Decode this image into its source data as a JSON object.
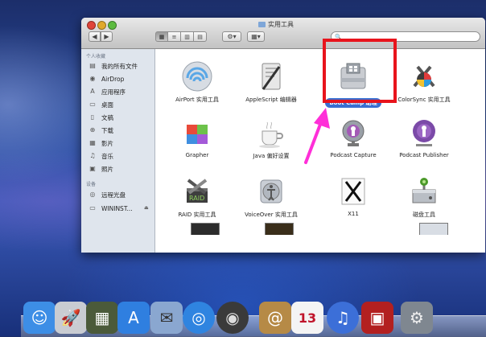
{
  "window": {
    "title": "实用工具",
    "search_placeholder": ""
  },
  "toolbar": {
    "back_label": "◀",
    "forward_label": "▶",
    "view_icon_label": "▦",
    "view_list_label": "≡",
    "view_column_label": "▥",
    "view_coverflow_label": "▤",
    "action_label": "⚙▾",
    "arrange_label": "▦▾",
    "search_glyph": "🔍"
  },
  "sidebar": {
    "favorites_header": "个人收藏",
    "favorites": [
      {
        "label": "我的所有文件",
        "icon": "all-files-icon",
        "glyph": "▤"
      },
      {
        "label": "AirDrop",
        "icon": "airdrop-icon",
        "glyph": "◉"
      },
      {
        "label": "应用程序",
        "icon": "applications-icon",
        "glyph": "A"
      },
      {
        "label": "桌面",
        "icon": "desktop-icon",
        "glyph": "▭"
      },
      {
        "label": "文稿",
        "icon": "documents-icon",
        "glyph": "▯"
      },
      {
        "label": "下载",
        "icon": "downloads-icon",
        "glyph": "⊕"
      },
      {
        "label": "影片",
        "icon": "movies-icon",
        "glyph": "▦"
      },
      {
        "label": "音乐",
        "icon": "music-icon",
        "glyph": "♫"
      },
      {
        "label": "照片",
        "icon": "photos-icon",
        "glyph": "▣"
      }
    ],
    "devices_header": "设备",
    "devices": [
      {
        "label": "远程光盘",
        "icon": "remote-disc-icon",
        "glyph": "◎"
      },
      {
        "label": "WININST...",
        "icon": "drive-icon",
        "glyph": "▭",
        "eject": "⏏"
      }
    ]
  },
  "apps": [
    {
      "label": "AirPort 实用工具",
      "icon": "airport-utility-icon"
    },
    {
      "label": "AppleScript 编辑器",
      "icon": "applescript-editor-icon"
    },
    {
      "label": "Boot Camp 助理",
      "icon": "boot-camp-icon",
      "selected": true
    },
    {
      "label": "ColorSync 实用工具",
      "icon": "colorsync-icon"
    },
    {
      "label": "Grapher",
      "icon": "grapher-icon"
    },
    {
      "label": "Java 偏好设置",
      "icon": "java-icon"
    },
    {
      "label": "Podcast Capture",
      "icon": "podcast-capture-icon"
    },
    {
      "label": "Podcast Publisher",
      "icon": "podcast-publisher-icon"
    },
    {
      "label": "RAID 实用工具",
      "icon": "raid-utility-icon"
    },
    {
      "label": "VoiceOver 实用工具",
      "icon": "voiceover-icon"
    },
    {
      "label": "X11",
      "icon": "x11-icon"
    },
    {
      "label": "磁盘工具",
      "icon": "disk-utility-icon"
    }
  ],
  "colors": {
    "highlight": "#e8141c",
    "arrow": "#ff2fd8",
    "selection": "#3a6fd1"
  },
  "dock": [
    {
      "icon": "finder-icon",
      "glyph": "☺"
    },
    {
      "icon": "launchpad-icon",
      "glyph": "🚀"
    },
    {
      "icon": "mission-control-icon",
      "glyph": "▦"
    },
    {
      "icon": "app-store-icon",
      "glyph": "A"
    },
    {
      "icon": "preview-icon",
      "glyph": "✉"
    },
    {
      "icon": "safari-icon",
      "glyph": "◎"
    },
    {
      "icon": "facetime-icon",
      "glyph": "◉"
    },
    {
      "icon": "contacts-icon",
      "glyph": "@"
    },
    {
      "icon": "calendar-icon",
      "glyph": "13"
    },
    {
      "icon": "itunes-icon",
      "glyph": "♫"
    },
    {
      "icon": "photo-booth-icon",
      "glyph": "▣"
    },
    {
      "icon": "system-preferences-icon",
      "glyph": "⚙"
    }
  ]
}
